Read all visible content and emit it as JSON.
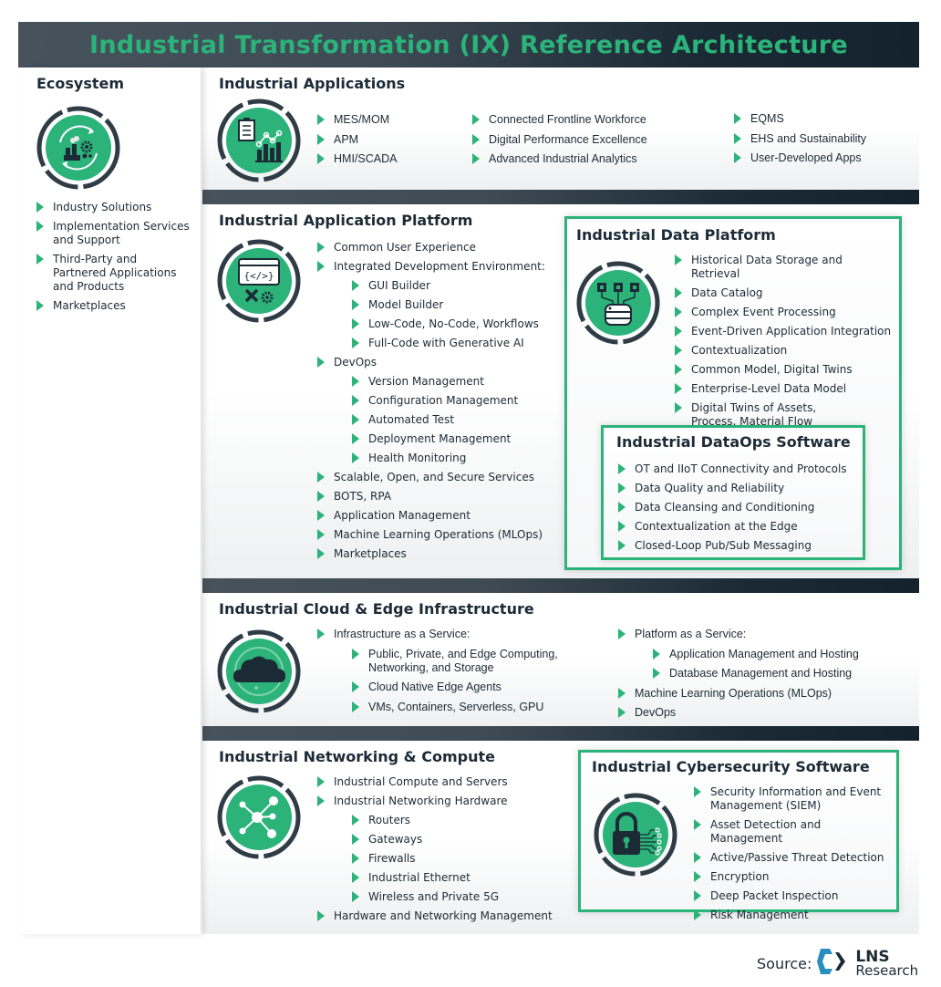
{
  "title": "Industrial Transformation (IX) Reference Architecture",
  "colors": {
    "accent": "#2bb37a",
    "dark": "#1b2a35",
    "text": "#1c2b36"
  },
  "ecosystem": {
    "heading": "Ecosystem",
    "icon": "factory-gears-cycle-icon",
    "items": [
      "Industry Solutions",
      "Implementation Services and Support",
      "Third-Party and Partnered Applications and Products",
      "Marketplaces"
    ]
  },
  "applications": {
    "heading": "Industrial Applications",
    "icon": "clipboard-chart-icon",
    "col1": [
      "MES/MOM",
      "APM",
      "HMI/SCADA"
    ],
    "col2": [
      "Connected Frontline Workforce",
      "Digital Performance Excellence",
      "Advanced Industrial Analytics"
    ],
    "col3": [
      "EQMS",
      "EHS and Sustainability",
      "User-Developed Apps"
    ]
  },
  "app_platform": {
    "heading": "Industrial Application Platform",
    "icon": "code-window-tools-icon",
    "items": [
      {
        "text": "Common User Experience",
        "level": 1
      },
      {
        "text": "Integrated Development Environment:",
        "level": 1
      },
      {
        "text": "GUI Builder",
        "level": 2
      },
      {
        "text": "Model Builder",
        "level": 2
      },
      {
        "text": "Low-Code, No-Code, Workflows",
        "level": 2
      },
      {
        "text": "Full-Code with Generative AI",
        "level": 2
      },
      {
        "text": "DevOps",
        "level": 1
      },
      {
        "text": "Version Management",
        "level": 2
      },
      {
        "text": "Configuration Management",
        "level": 2
      },
      {
        "text": "Automated Test",
        "level": 2
      },
      {
        "text": "Deployment Management",
        "level": 2
      },
      {
        "text": "Health Monitoring",
        "level": 2
      },
      {
        "text": "Scalable, Open, and Secure Services",
        "level": 1
      },
      {
        "text": "BOTS, RPA",
        "level": 1
      },
      {
        "text": "Application Management",
        "level": 1
      },
      {
        "text": "Machine Learning Operations (MLOps)",
        "level": 1
      },
      {
        "text": "Marketplaces",
        "level": 1
      }
    ]
  },
  "data_platform": {
    "heading": "Industrial Data Platform",
    "icon": "database-nodes-icon",
    "items": [
      "Historical Data Storage and Retrieval",
      "Data Catalog",
      "Complex Event Processing",
      "Event-Driven Application Integration",
      "Contextualization",
      "Common Model, Digital Twins",
      "Enterprise-Level Data Model",
      "Digital Twins of Assets, Process, Material Flow"
    ]
  },
  "dataops": {
    "heading": "Industrial DataOps Software",
    "items": [
      "OT and IIoT Connectivity and Protocols",
      "Data Quality and Reliability",
      "Data Cleansing and Conditioning",
      "Contextualization at the Edge",
      "Closed-Loop Pub/Sub Messaging"
    ]
  },
  "cloud_edge": {
    "heading": "Industrial Cloud & Edge Infrastructure",
    "icon": "cloud-icon",
    "left": [
      {
        "text": "Infrastructure as a Service:",
        "level": 1
      },
      {
        "text": "Public, Private, and Edge Computing, Networking, and Storage",
        "level": 2
      },
      {
        "text": "Cloud Native Edge Agents",
        "level": 2
      },
      {
        "text": "VMs, Containers, Serverless, GPU",
        "level": 2
      }
    ],
    "right": [
      {
        "text": "Platform as a Service:",
        "level": 1
      },
      {
        "text": "Application Management and Hosting",
        "level": 2
      },
      {
        "text": "Database Management and Hosting",
        "level": 2
      },
      {
        "text": "Machine Learning Operations (MLOps)",
        "level": 1
      },
      {
        "text": "DevOps",
        "level": 1
      }
    ]
  },
  "networking": {
    "heading": "Industrial Networking & Compute",
    "icon": "network-nodes-icon",
    "items": [
      {
        "text": "Industrial Compute and Servers",
        "level": 1
      },
      {
        "text": "Industrial Networking Hardware",
        "level": 1
      },
      {
        "text": "Routers",
        "level": 2
      },
      {
        "text": "Gateways",
        "level": 2
      },
      {
        "text": "Firewalls",
        "level": 2
      },
      {
        "text": "Industrial Ethernet",
        "level": 2
      },
      {
        "text": "Wireless and Private 5G",
        "level": 2
      },
      {
        "text": "Hardware and Networking Management",
        "level": 1
      }
    ]
  },
  "cybersecurity": {
    "heading": "Industrial Cybersecurity Software",
    "icon": "padlock-circuit-icon",
    "items": [
      "Security Information and Event Management (SIEM)",
      "Asset Detection and Management",
      "Active/Passive Threat Detection",
      "Encryption",
      "Deep Packet Inspection",
      "Risk Management"
    ]
  },
  "source": {
    "label": "Source:",
    "brand_top": "LNS",
    "brand_bottom": "Research"
  }
}
